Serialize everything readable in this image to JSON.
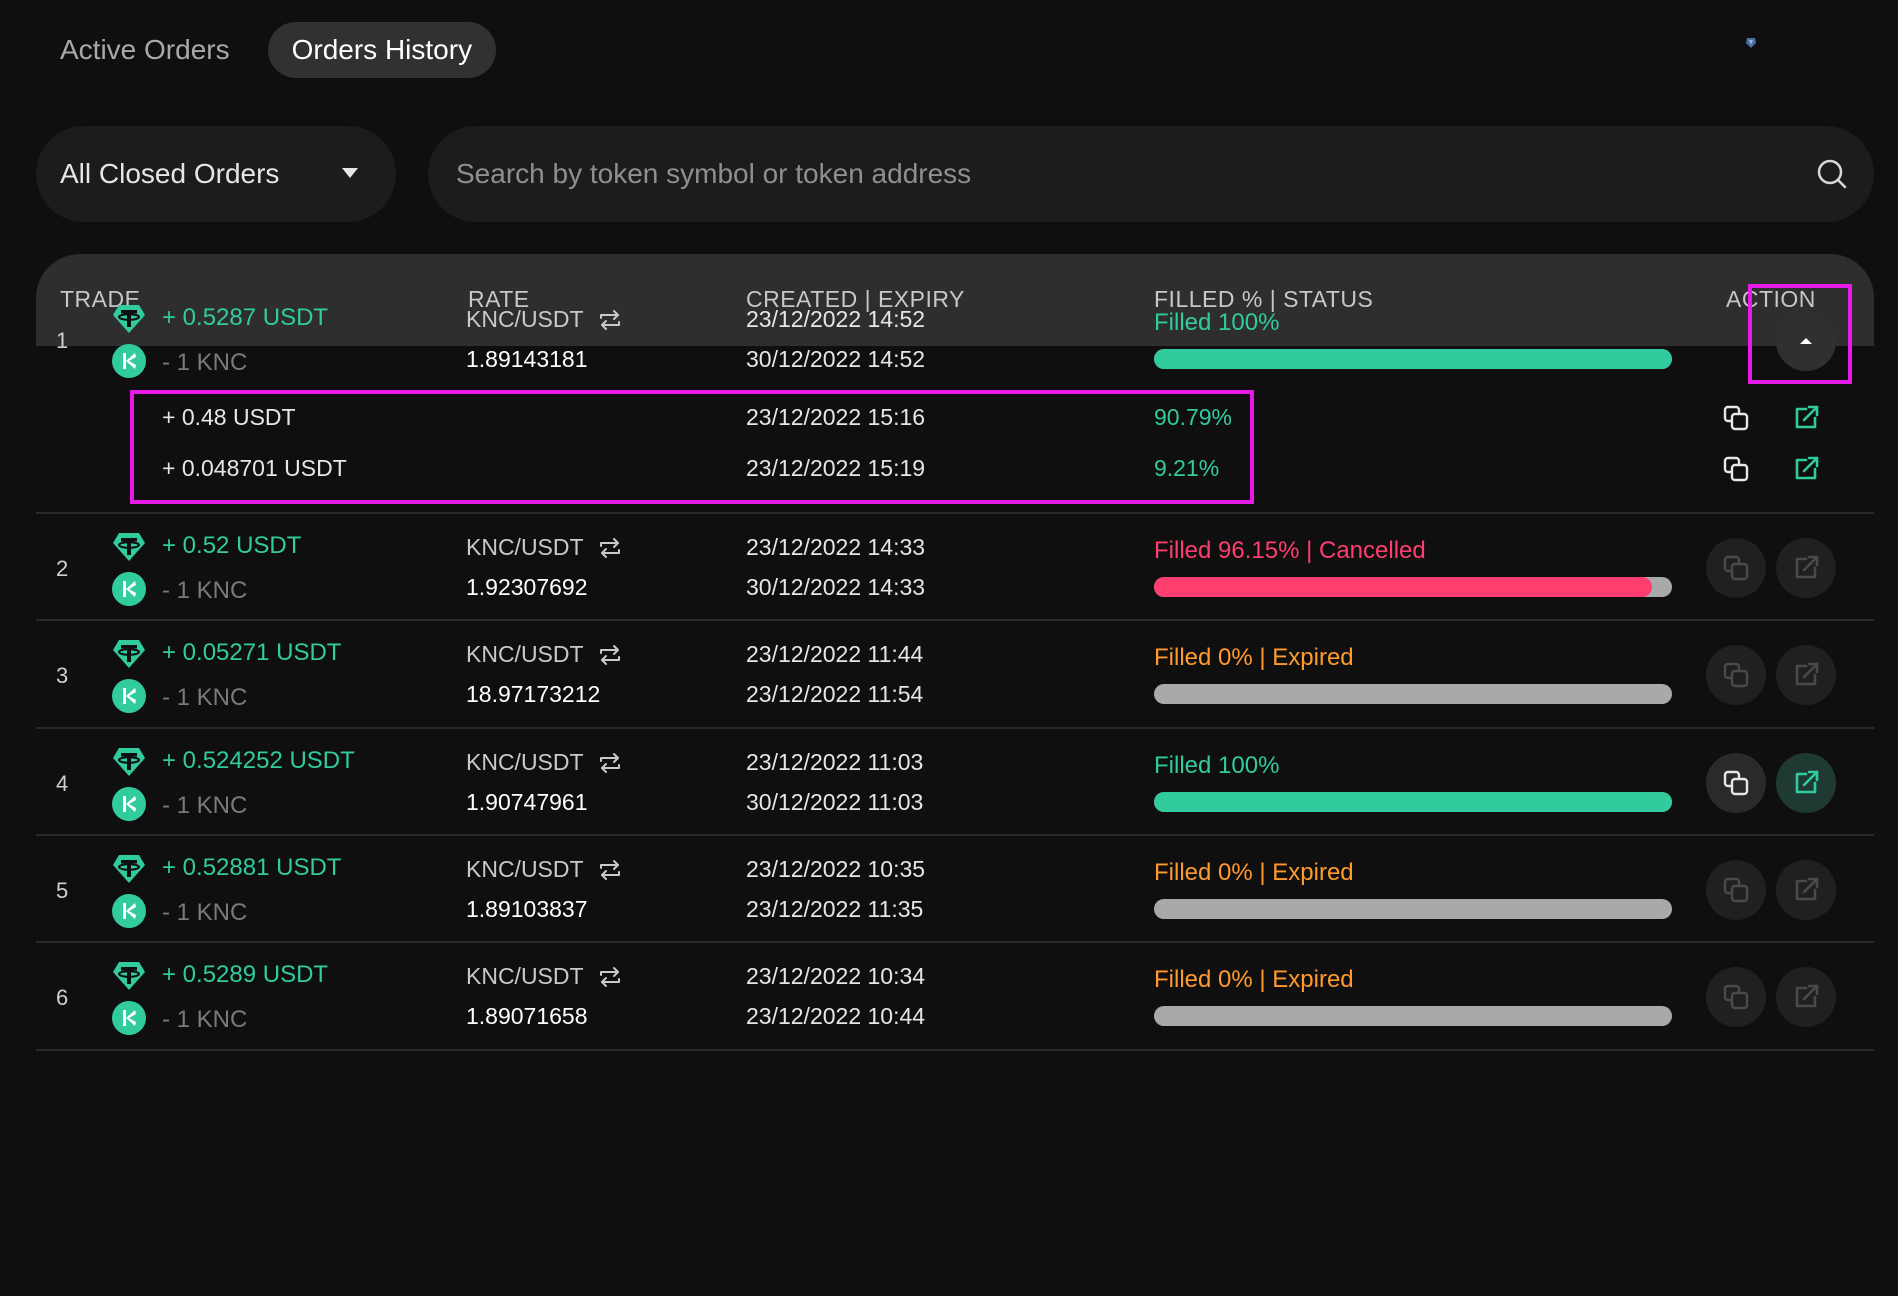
{
  "tabs": [
    {
      "label": "Active Orders",
      "active": false
    },
    {
      "label": "Orders History",
      "active": true
    }
  ],
  "filter": {
    "label": "All Closed Orders"
  },
  "search": {
    "placeholder": "Search by token symbol or token address"
  },
  "columns": {
    "trade": "TRADE",
    "rate": "RATE",
    "created_expiry": "CREATED | EXPIRY",
    "filled_status": "FILLED % | STATUS",
    "action": "ACTION"
  },
  "colors": {
    "green": "#31cb9e",
    "red": "#ff3d6e",
    "orange": "#ff9a2e",
    "gray_bar": "#a9a9a9",
    "highlight": "#e81ae8"
  },
  "orders": [
    {
      "index": "1",
      "receive": "+ 0.5287 USDT",
      "pay": "- 1 KNC",
      "pair": "KNC/USDT",
      "rate": "1.89143181",
      "created": "23/12/2022 14:52",
      "expiry": "30/12/2022 14:52",
      "status": "Filled 100%",
      "status_color": "#31cb9e",
      "fill_fraction": 1.0,
      "fill_color": "#31cb9e",
      "expanded": true
    },
    {
      "index": "2",
      "receive": "+ 0.52 USDT",
      "pay": "- 1 KNC",
      "pair": "KNC/USDT",
      "rate": "1.92307692",
      "created": "23/12/2022 14:33",
      "expiry": "30/12/2022 14:33",
      "status": "Filled 96.15% | Cancelled",
      "status_color": "#ff3d6e",
      "fill_fraction": 0.9615,
      "fill_color": "#ff3d6e",
      "expanded": false
    },
    {
      "index": "3",
      "receive": "+ 0.05271 USDT",
      "pay": "- 1 KNC",
      "pair": "KNC/USDT",
      "rate": "18.97173212",
      "created": "23/12/2022 11:44",
      "expiry": "23/12/2022 11:54",
      "status": "Filled 0% | Expired",
      "status_color": "#ff9a2e",
      "fill_fraction": 0,
      "fill_color": "#a9a9a9",
      "expanded": false
    },
    {
      "index": "4",
      "receive": "+ 0.524252 USDT",
      "pay": "- 1 KNC",
      "pair": "KNC/USDT",
      "rate": "1.90747961",
      "created": "23/12/2022 11:03",
      "expiry": "30/12/2022 11:03",
      "status": "Filled 100%",
      "status_color": "#31cb9e",
      "fill_fraction": 1.0,
      "fill_color": "#31cb9e",
      "expanded": false
    },
    {
      "index": "5",
      "receive": "+ 0.52881 USDT",
      "pay": "- 1 KNC",
      "pair": "KNC/USDT",
      "rate": "1.89103837",
      "created": "23/12/2022 10:35",
      "expiry": "23/12/2022 11:35",
      "status": "Filled 0% | Expired",
      "status_color": "#ff9a2e",
      "fill_fraction": 0,
      "fill_color": "#a9a9a9",
      "expanded": false
    },
    {
      "index": "6",
      "receive": "+ 0.5289 USDT",
      "pay": "- 1 KNC",
      "pair": "KNC/USDT",
      "rate": "1.89071658",
      "created": "23/12/2022 10:34",
      "expiry": "23/12/2022 10:44",
      "status": "Filled 0% | Expired",
      "status_color": "#ff9a2e",
      "fill_fraction": 0,
      "fill_color": "#a9a9a9",
      "expanded": false
    }
  ],
  "fills": [
    {
      "amount": "+ 0.48 USDT",
      "time": "23/12/2022 15:16",
      "percent": "90.79%"
    },
    {
      "amount": "+ 0.048701 USDT",
      "time": "23/12/2022 15:19",
      "percent": "9.21%"
    }
  ]
}
